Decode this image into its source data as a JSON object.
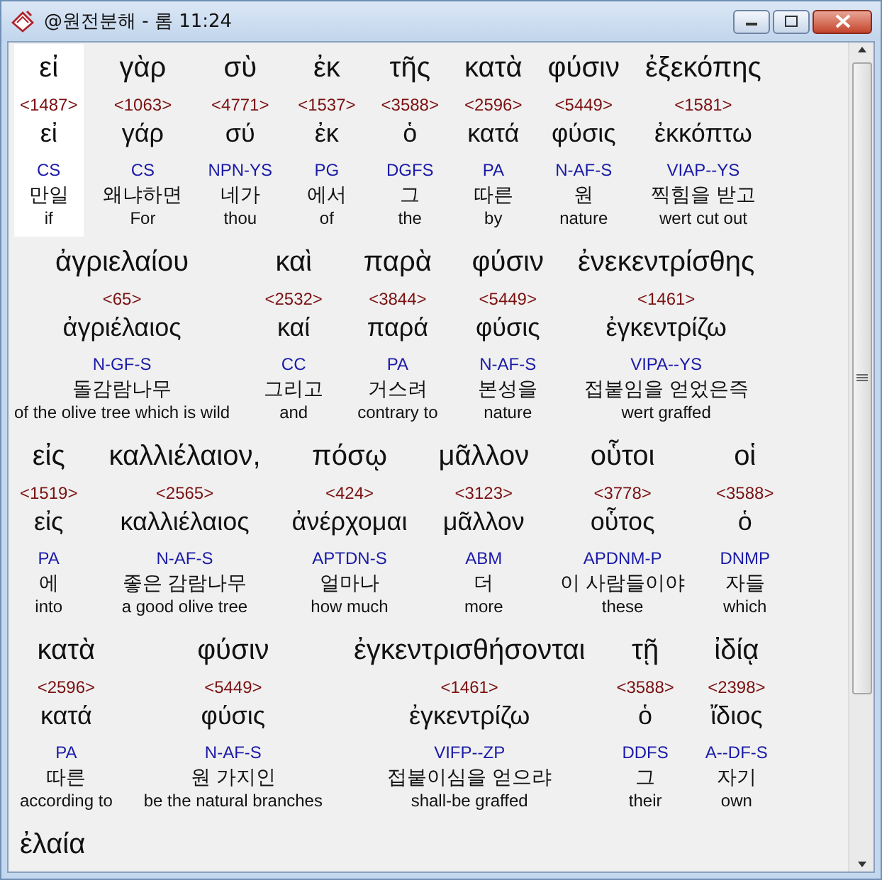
{
  "window": {
    "title": "@원전분해 - 롬 11:24"
  },
  "rows": [
    {
      "words": [
        {
          "greek": "εἰ",
          "strong": "<1487>",
          "lexeme": "εἰ",
          "parsing": "CS",
          "korean": "만일",
          "english": "if",
          "selected": true
        },
        {
          "greek": "γὰρ",
          "strong": "<1063>",
          "lexeme": "γάρ",
          "parsing": "CS",
          "korean": "왜냐하면",
          "english": "For",
          "selected": false
        },
        {
          "greek": "σὺ",
          "strong": "<4771>",
          "lexeme": "σύ",
          "parsing": "NPN-YS",
          "korean": "네가",
          "english": "thou",
          "selected": false
        },
        {
          "greek": "ἐκ",
          "strong": "<1537>",
          "lexeme": "ἐκ",
          "parsing": "PG",
          "korean": "에서",
          "english": "of",
          "selected": false
        },
        {
          "greek": "τῆς",
          "strong": "<3588>",
          "lexeme": "ὁ",
          "parsing": "DGFS",
          "korean": "그",
          "english": "the",
          "selected": false
        },
        {
          "greek": "κατὰ",
          "strong": "<2596>",
          "lexeme": "κατά",
          "parsing": "PA",
          "korean": "따른",
          "english": "by",
          "selected": false
        },
        {
          "greek": "φύσιν",
          "strong": "<5449>",
          "lexeme": "φύσις",
          "parsing": "N-AF-S",
          "korean": "원",
          "english": "nature",
          "selected": false
        },
        {
          "greek": "ἐξεκόπης",
          "strong": "<1581>",
          "lexeme": "ἐκκόπτω",
          "parsing": "VIAP--YS",
          "korean": "찍힘을 받고",
          "english": "wert cut out",
          "selected": false
        }
      ]
    },
    {
      "words": [
        {
          "greek": "ἀγριελαίου",
          "strong": "<65>",
          "lexeme": "ἀγριέλαιος",
          "parsing": "N-GF-S",
          "korean": "돌감람나무",
          "english": "of the olive tree which is wild",
          "selected": false
        },
        {
          "greek": "καὶ",
          "strong": "<2532>",
          "lexeme": "καί",
          "parsing": "CC",
          "korean": "그리고",
          "english": "and",
          "selected": false
        },
        {
          "greek": "παρὰ",
          "strong": "<3844>",
          "lexeme": "παρά",
          "parsing": "PA",
          "korean": "거스려",
          "english": "contrary to",
          "selected": false
        },
        {
          "greek": "φύσιν",
          "strong": "<5449>",
          "lexeme": "φύσις",
          "parsing": "N-AF-S",
          "korean": "본성을",
          "english": "nature",
          "selected": false
        },
        {
          "greek": "ἐνεκεντρίσθης",
          "strong": "<1461>",
          "lexeme": "ἐγκεντρίζω",
          "parsing": "VIPA--YS",
          "korean": "접붙임을 얻었은즉",
          "english": "wert graffed",
          "selected": false
        }
      ]
    },
    {
      "words": [
        {
          "greek": "εἰς",
          "strong": "<1519>",
          "lexeme": "εἰς",
          "parsing": "PA",
          "korean": "에",
          "english": "into",
          "selected": false
        },
        {
          "greek": "καλλιέλαιον,",
          "strong": "<2565>",
          "lexeme": "καλλιέλαιος",
          "parsing": "N-AF-S",
          "korean": "좋은 감람나무",
          "english": "a good olive tree",
          "selected": false
        },
        {
          "greek": "πόσῳ",
          "strong": "<424>",
          "lexeme": "ἀνέρχομαι",
          "parsing": "APTDN-S",
          "korean": "얼마나",
          "english": "how much",
          "selected": false
        },
        {
          "greek": "μᾶλλον",
          "strong": "<3123>",
          "lexeme": "μᾶλλον",
          "parsing": "ABM",
          "korean": "더",
          "english": "more",
          "selected": false
        },
        {
          "greek": "οὗτοι",
          "strong": "<3778>",
          "lexeme": "οὗτος",
          "parsing": "APDNM-P",
          "korean": "이 사람들이야",
          "english": "these",
          "selected": false
        },
        {
          "greek": "οἱ",
          "strong": "<3588>",
          "lexeme": "ὁ",
          "parsing": "DNMP",
          "korean": "자들",
          "english": "which",
          "selected": false
        }
      ]
    },
    {
      "words": [
        {
          "greek": "κατὰ",
          "strong": "<2596>",
          "lexeme": "κατά",
          "parsing": "PA",
          "korean": "따른",
          "english": "according to",
          "selected": false
        },
        {
          "greek": "φύσιν",
          "strong": "<5449>",
          "lexeme": "φύσις",
          "parsing": "N-AF-S",
          "korean": "원 가지인",
          "english": "be the natural branches",
          "selected": false
        },
        {
          "greek": "ἐγκεντρισθήσονται",
          "strong": "<1461>",
          "lexeme": "ἐγκεντρίζω",
          "parsing": "VIFP--ZP",
          "korean": "접붙이심을 얻으랴",
          "english": "shall-be graffed",
          "selected": false
        },
        {
          "greek": "τῇ",
          "strong": "<3588>",
          "lexeme": "ὁ",
          "parsing": "DDFS",
          "korean": "그",
          "english": "their",
          "selected": false
        },
        {
          "greek": "ἰδίᾳ",
          "strong": "<2398>",
          "lexeme": "ἴδιος",
          "parsing": "A--DF-S",
          "korean": "자기",
          "english": "own",
          "selected": false
        }
      ]
    },
    {
      "words": [
        {
          "greek": "ἐλαία",
          "selected": false
        }
      ]
    }
  ]
}
